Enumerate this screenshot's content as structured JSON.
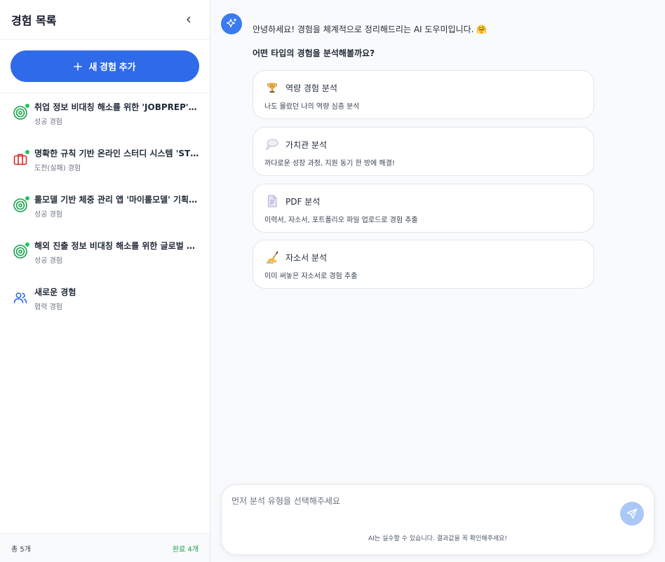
{
  "sidebar": {
    "title": "경험 목록",
    "add_button": "새 경험 추가",
    "items": [
      {
        "title": "취업 정보 비대칭 해소를 위한 'JOBPREP' 서비스 기획",
        "subtitle": "성공 경험",
        "icon": "target-icon"
      },
      {
        "title": "명확한 규칙 기반 온라인 스터디 시스템 'STUDY' 운영",
        "subtitle": "도전(실패) 경험",
        "icon": "briefcase-icon"
      },
      {
        "title": "롤모델 기반 체중 관리 앱 '마이롤모델' 기획 및 개발",
        "subtitle": "성공 경험",
        "icon": "target-icon"
      },
      {
        "title": "해외 진출 정보 비대칭 해소를 위한 글로벌 플랫폼 기획",
        "subtitle": "성공 경험",
        "icon": "target-icon"
      },
      {
        "title": "새로운 경험",
        "subtitle": "협력 경험",
        "icon": "users-icon"
      }
    ],
    "footer": {
      "total": "총 5개",
      "done": "완료 4개"
    }
  },
  "chat": {
    "greeting": "안녕하세요! 경험을 체계적으로 정리해드리는 AI 도우미입니다. 🤗",
    "question": "어떤 타입의 경험을 분석해볼까요?",
    "options": [
      {
        "emoji": "🏆",
        "label": "역량 경험 분석",
        "desc": "나도 몰랐던 나의 역량 심층 분석"
      },
      {
        "emoji": "💭",
        "label": "가치관 분석",
        "desc": "까다로운 성장 과정, 지원 동기 한 방에 해결!"
      },
      {
        "emoji": "📄",
        "label": "PDF 분석",
        "desc": "이력서, 자소서, 포트폴리오 파일 업로드로 경험 추출"
      },
      {
        "emoji": "✍️",
        "label": "자소서 분석",
        "desc": "이미 써놓은 자소서로 경험 추출"
      }
    ]
  },
  "input": {
    "placeholder": "먼저 분석 유형을 선택해주세요",
    "disclaimer": "AI는 실수할 수 있습니다. 결과값을 꼭 확인해주세요!"
  },
  "colors": {
    "accent": "#2f6ae9",
    "success": "#22c55e",
    "danger": "#dc2626",
    "send_disabled": "#a9c8f8"
  }
}
